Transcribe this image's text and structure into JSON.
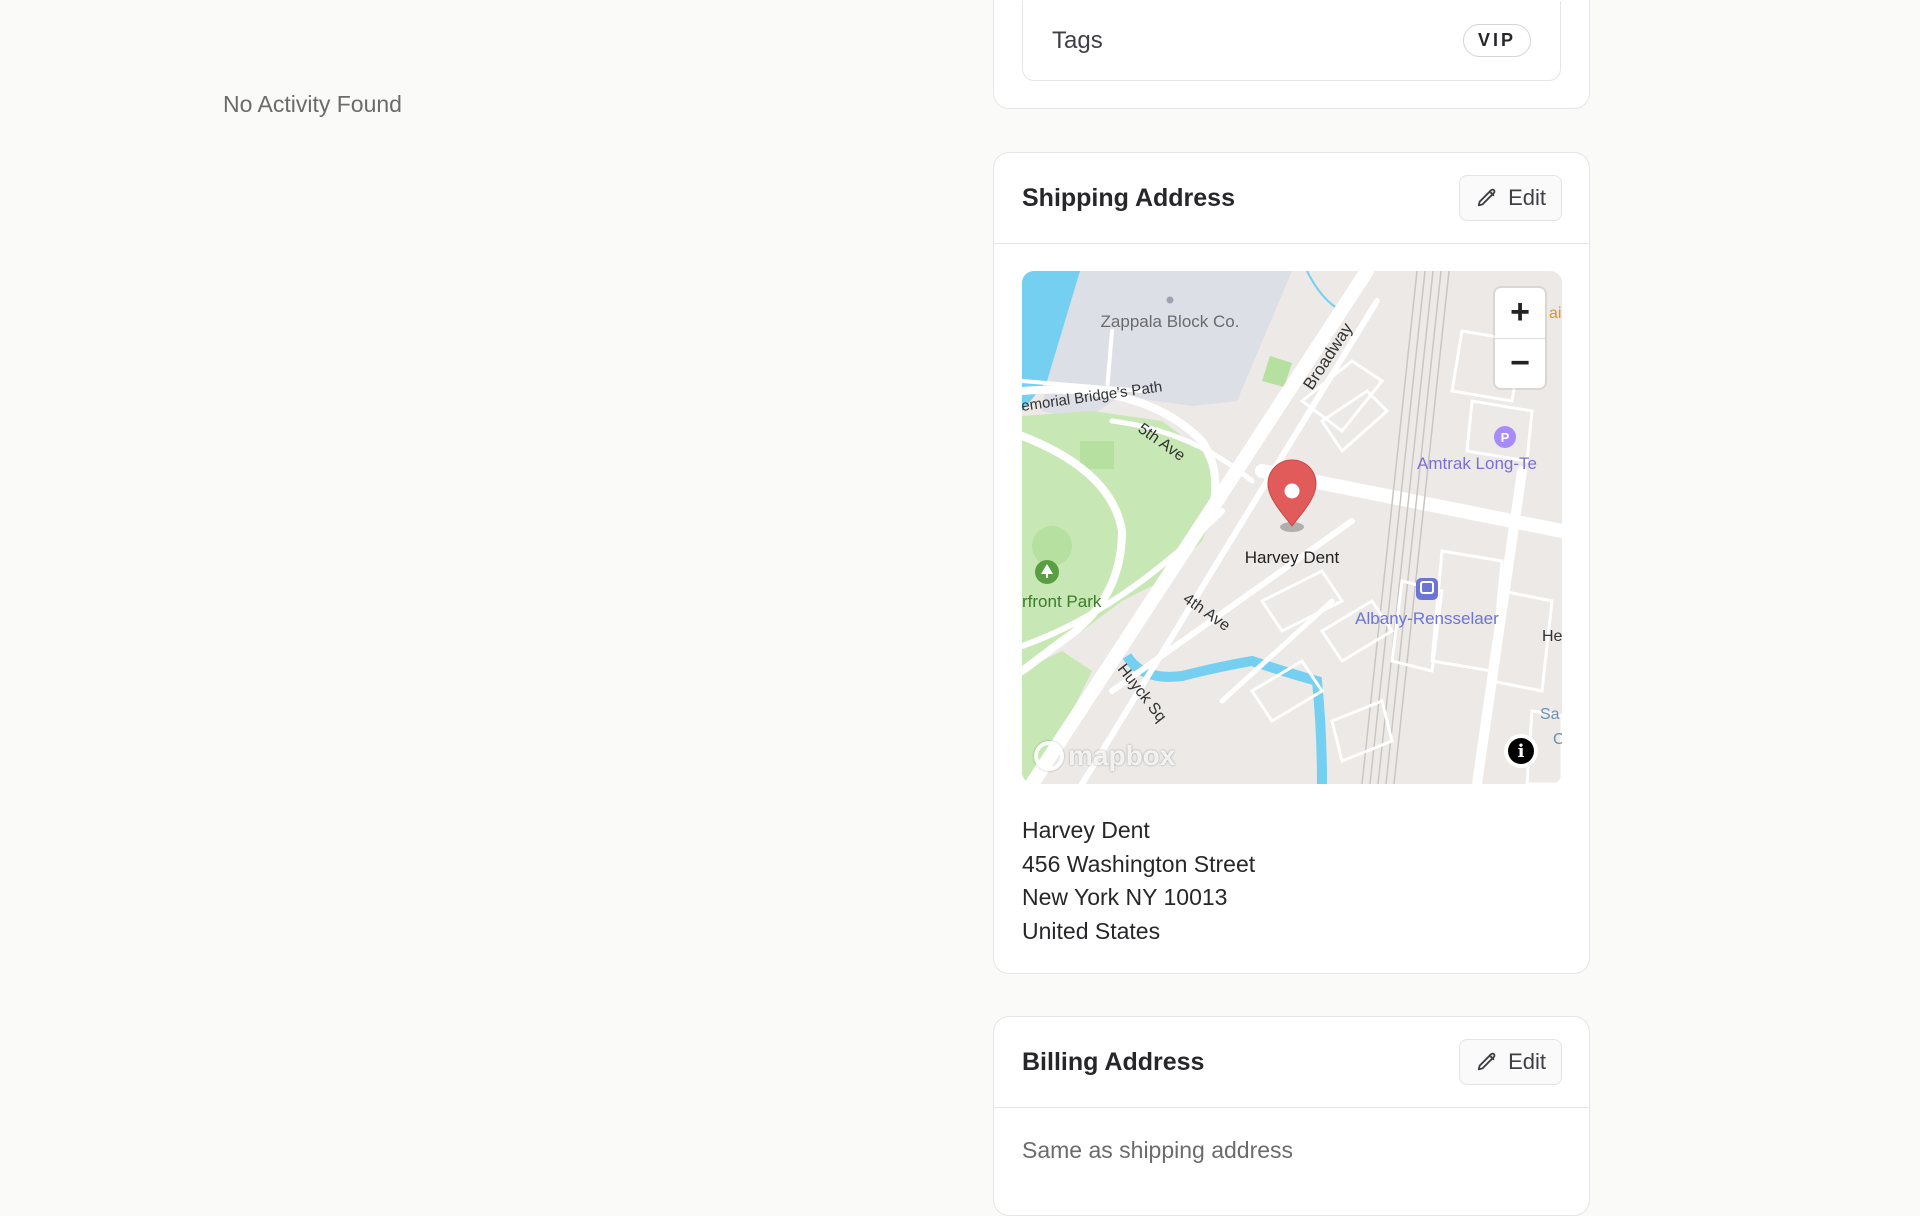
{
  "activity": {
    "empty_text": "No Activity Found"
  },
  "tags_card": {
    "label": "Tags",
    "tags": [
      "VIP"
    ]
  },
  "shipping": {
    "title": "Shipping Address",
    "edit_label": "Edit",
    "map": {
      "labels": {
        "zappala": "Zappala Block Co.",
        "broadway": "Broadway",
        "bridge_path": "emorial Bridge's Path",
        "fifth_ave": "5th Ave",
        "amtrak": "Amtrak Long-Te",
        "marker_name": "Harvey Dent",
        "park": "rfront Park",
        "fourth_ave": "4th Ave",
        "station": "Albany-Rensselaer",
        "huyck": "Huyck Sq",
        "edge_he": "He",
        "edge_sa": "Sa",
        "edge_c": "C",
        "edge_ai": "ai"
      },
      "zoom_in": "+",
      "zoom_out": "−",
      "attribution": "mapbox",
      "info": "i"
    },
    "address_lines": {
      "name": "Harvey Dent",
      "street": "456 Washington Street",
      "city": "New York NY 10013",
      "country": "United States"
    }
  },
  "billing": {
    "title": "Billing Address",
    "edit_label": "Edit",
    "note": "Same as shipping address"
  },
  "colors": {
    "page_bg": "#fafaf9",
    "card_border": "#e7e5e4",
    "marker": "#e15b5b",
    "water": "#75cff0",
    "park": "#c7e8b4",
    "poi_purple": "#7b6fd6"
  }
}
